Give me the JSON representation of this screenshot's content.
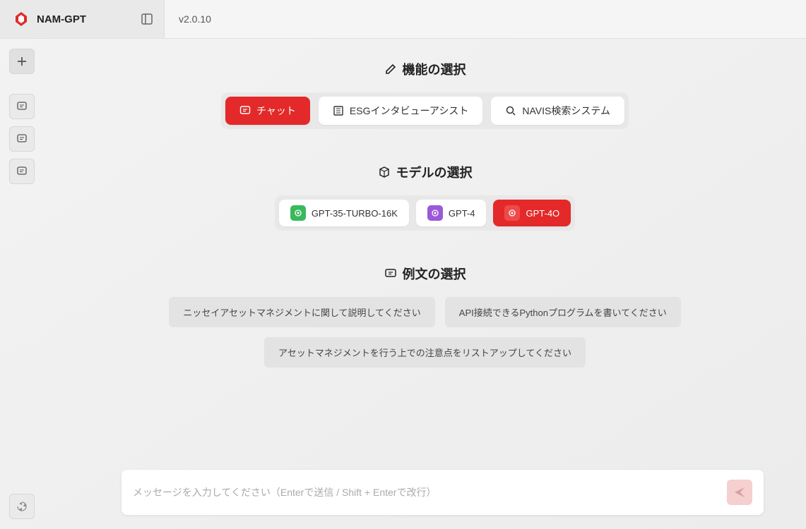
{
  "header": {
    "appTitle": "NAM-GPT",
    "version": "v2.0.10"
  },
  "sections": {
    "function": {
      "title": "機能の選択",
      "options": [
        {
          "label": "チャット",
          "active": true
        },
        {
          "label": "ESGインタビューアシスト",
          "active": false
        },
        {
          "label": "NAVIS検索システム",
          "active": false
        }
      ]
    },
    "model": {
      "title": "モデルの選択",
      "options": [
        {
          "label": "GPT-35-TURBO-16K",
          "active": false
        },
        {
          "label": "GPT-4",
          "active": false
        },
        {
          "label": "GPT-4O",
          "active": true
        }
      ]
    },
    "examples": {
      "title": "例文の選択",
      "items": [
        "ニッセイアセットマネジメントに関して説明してください",
        "API接続できるPythonプログラムを書いてください",
        "アセットマネジメントを行う上での注意点をリストアップしてください"
      ]
    }
  },
  "input": {
    "placeholder": "メッセージを入力してください（Enterで送信 / Shift + Enterで改行）"
  }
}
